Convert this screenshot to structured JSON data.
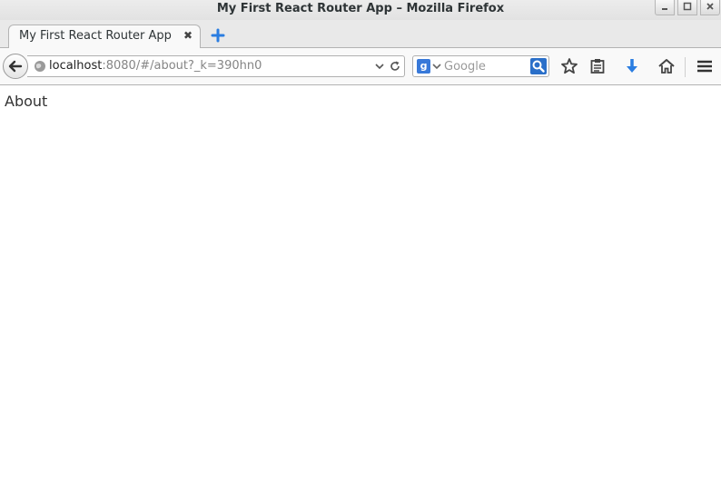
{
  "window": {
    "title": "My First React Router App – Mozilla Firefox"
  },
  "tabs": [
    {
      "label": "My First React Router App",
      "close": "✖"
    }
  ],
  "navbar": {
    "url_host": "localhost",
    "url_rest": ":8080/#/about?_k=390hn0",
    "search_engine": "g",
    "search_placeholder": "Google"
  },
  "page": {
    "heading": "About"
  },
  "icons": {
    "back": "back-arrow-icon",
    "globe": "globe-icon",
    "reload": "reload-icon",
    "search": "magnifier-icon",
    "bookmark": "star-icon",
    "reading_list": "clipboard-icon",
    "downloads": "download-arrow-icon",
    "home": "home-icon",
    "menu": "hamburger-menu-icon"
  },
  "colors": {
    "accent_blue": "#2a7de1",
    "url_host": "#222222",
    "url_rest": "#858585"
  }
}
